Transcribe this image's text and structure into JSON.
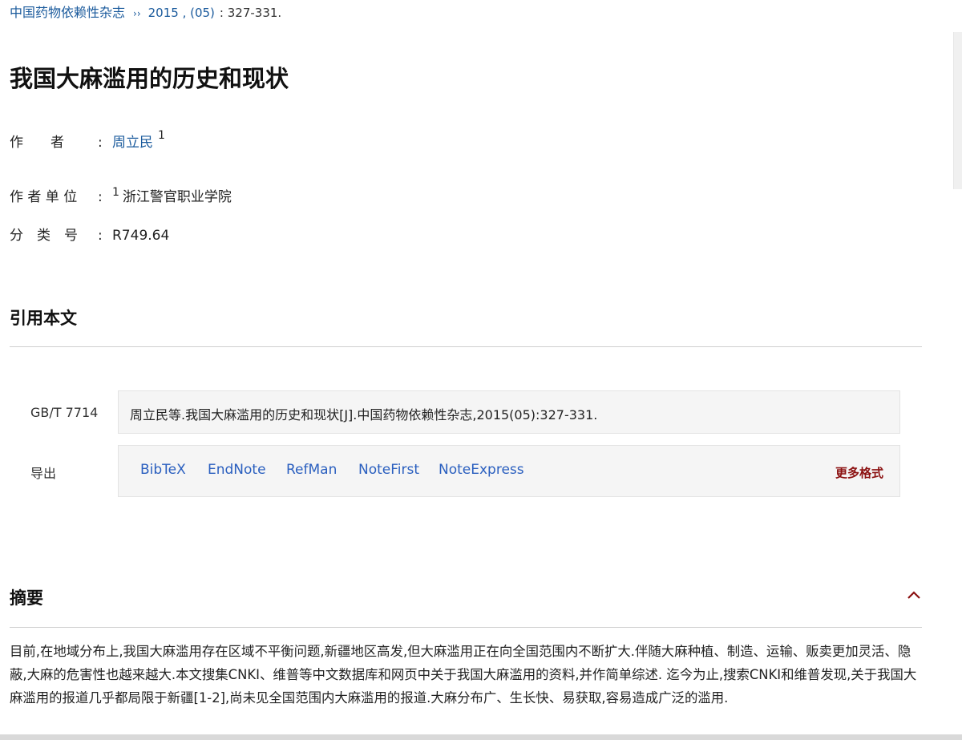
{
  "breadcrumb": {
    "journal": "中国药物依赖性杂志",
    "separator": "››",
    "issue": "2015 , (05)",
    "pages": ": 327-331."
  },
  "article": {
    "title": "我国大麻滥用的历史和现状"
  },
  "meta": {
    "author_label": "作　　者",
    "author_colon": ":",
    "author_name": "周立民",
    "author_sup": "1",
    "affiliation_label": "作 者 单 位",
    "affiliation_colon": ":",
    "affiliation_sup": "1",
    "affiliation_name": "浙江警官职业学院",
    "classification_label": "分　类　号",
    "classification_colon": ":",
    "classification_value": "R749.64"
  },
  "cite": {
    "section_title": "引用本文",
    "gbt_label": "GB/T 7714",
    "gbt_text": "周立民等.我国大麻滥用的历史和现状[J].中国药物依赖性杂志,2015(05):327-331.",
    "export_label": "导出",
    "export_formats": [
      "BibTeX",
      "EndNote",
      "RefMan",
      "NoteFirst",
      "NoteExpress"
    ],
    "more_formats": "更多格式"
  },
  "abstract": {
    "section_title": "摘要",
    "text": "目前,在地域分布上,我国大麻滥用存在区域不平衡问题,新疆地区高发,但大麻滥用正在向全国范围内不断扩大.伴随大麻种植、制造、运输、贩卖更加灵活、隐蔽,大麻的危害性也越来越大.本文搜集CNKI、维普等中文数据库和网页中关于我国大麻滥用的资料,并作简单综述. 迄今为止,搜索CNKI和维普发现,关于我国大麻滥用的报道几乎都局限于新疆[1-2],尚未见全国范围内大麻滥用的报道.大麻分布广、生长快、易获取,容易造成广泛的滥用."
  },
  "colors": {
    "link": "#1a5a9c",
    "export_link": "#2a5fbf",
    "more_formats": "#8b1010",
    "collapse_icon": "#8b1010"
  },
  "icons": {
    "collapse": "chevron-up-icon"
  }
}
